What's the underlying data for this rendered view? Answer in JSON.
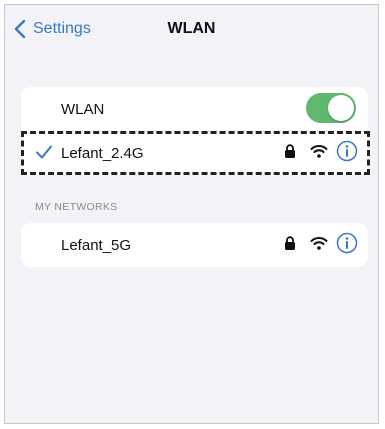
{
  "nav": {
    "back_label": "Settings",
    "title": "WLAN"
  },
  "wlan_row": {
    "label": "WLAN",
    "toggle_on": true
  },
  "connected_network": {
    "name": "Lefant_2.4G",
    "selected": true,
    "secured": true
  },
  "section_header": "MY NETWORKS",
  "my_networks": [
    {
      "name": "Lefant_5G",
      "secured": true
    }
  ],
  "colors": {
    "accent": "#3a78c4",
    "toggle_on": "#5fb86e",
    "background": "#f2f2f7"
  },
  "icons": {
    "back": "chevron-left-icon",
    "check": "checkmark-icon",
    "lock": "lock-icon",
    "wifi": "wifi-icon",
    "info": "info-icon"
  }
}
